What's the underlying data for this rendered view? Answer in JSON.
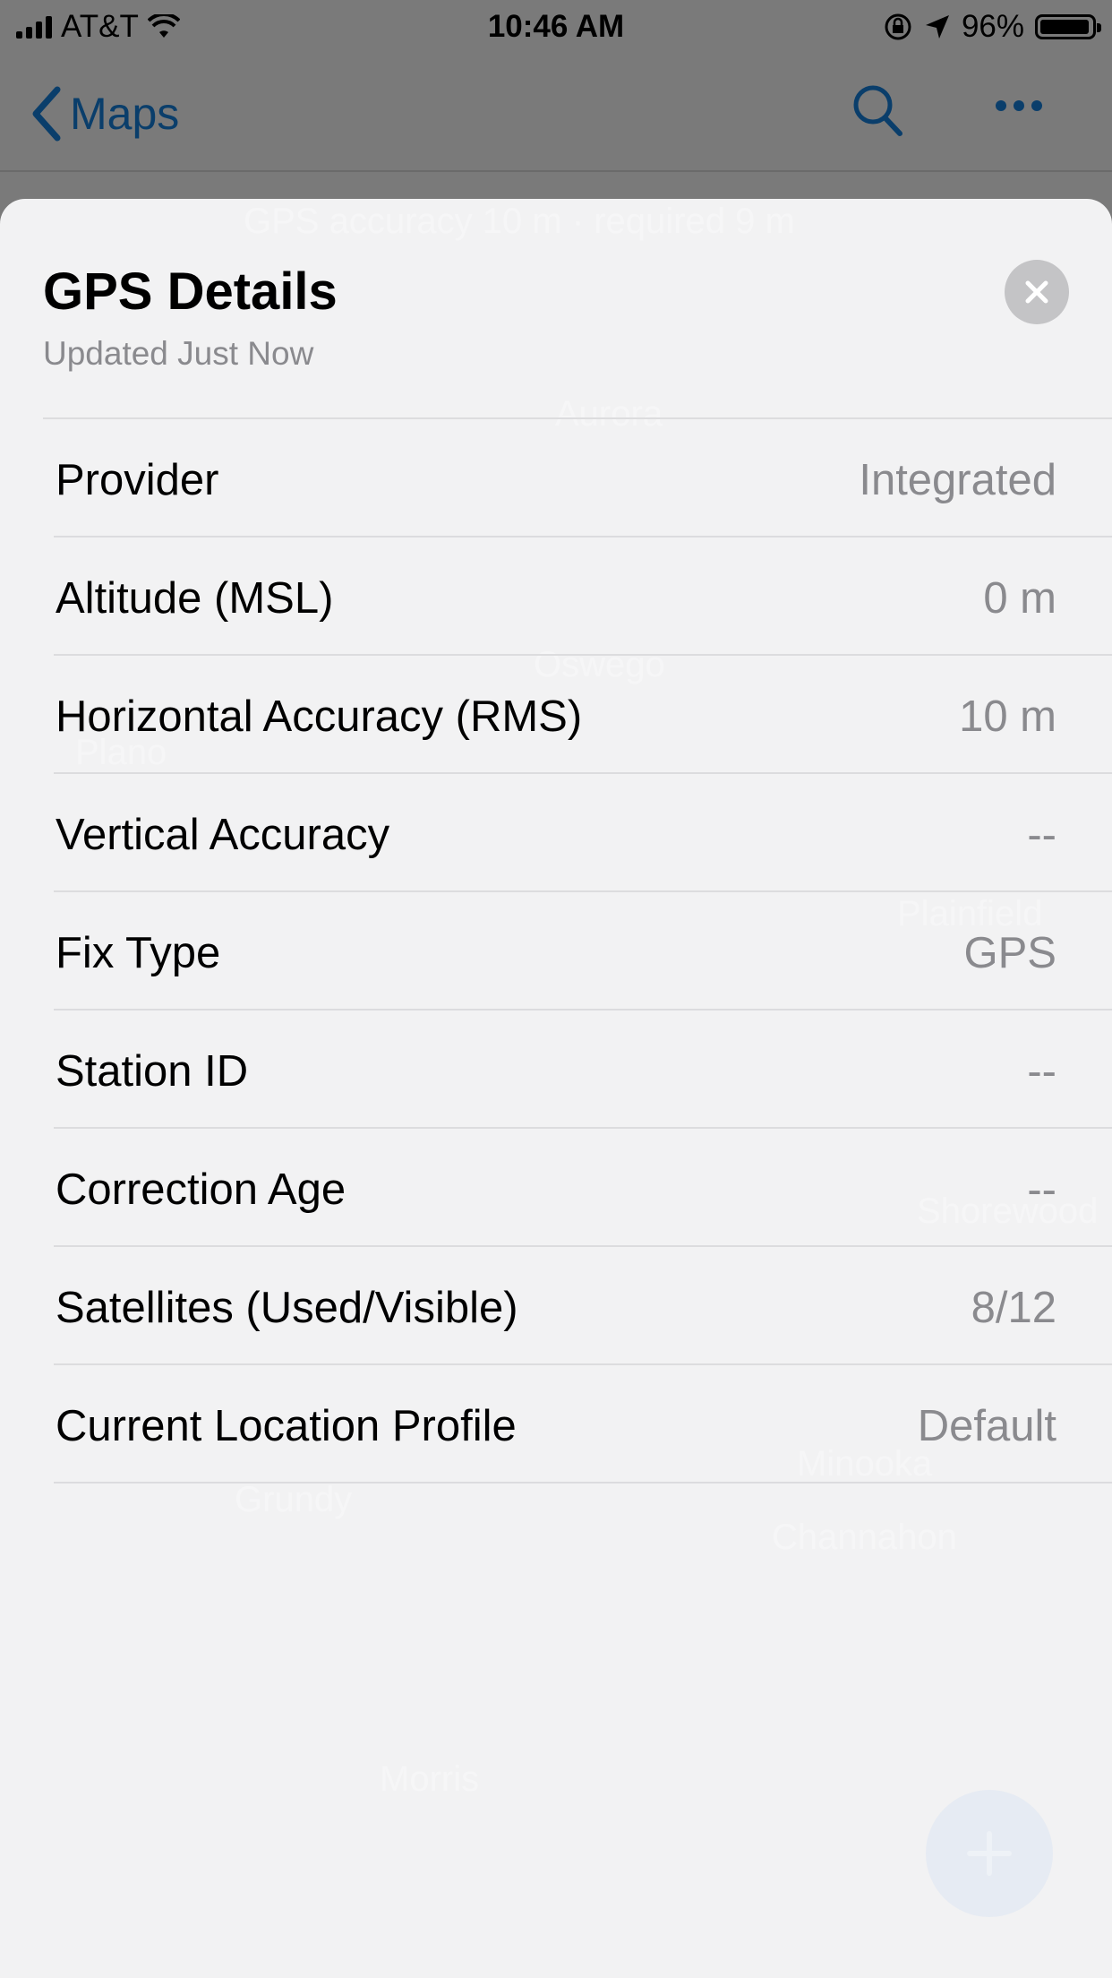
{
  "status_bar": {
    "carrier": "AT&T",
    "time": "10:46 AM",
    "battery_percent": "96%",
    "battery_level": 0.96,
    "icons": [
      "signal-icon",
      "wifi-icon",
      "rotation-lock-icon",
      "location-arrow-icon",
      "battery-icon"
    ]
  },
  "nav": {
    "back_label": "Maps",
    "icons": [
      "chevron-left-icon",
      "search-icon",
      "more-icon"
    ]
  },
  "background_map": {
    "banner": "GPS accuracy 10 m · required 9 m",
    "places": [
      "Aurora",
      "Oswego",
      "Plano",
      "Plainfield",
      "Shorewood",
      "Minooka",
      "Channahon",
      "Grundy",
      "Morris"
    ]
  },
  "sheet": {
    "title": "GPS Details",
    "subtitle": "Updated Just Now",
    "rows": [
      {
        "label": "Provider",
        "value": "Integrated"
      },
      {
        "label": "Altitude (MSL)",
        "value": "0 m"
      },
      {
        "label": "Horizontal Accuracy (RMS)",
        "value": "10 m"
      },
      {
        "label": "Vertical Accuracy",
        "value": "--"
      },
      {
        "label": "Fix Type",
        "value": "GPS"
      },
      {
        "label": "Station ID",
        "value": "--"
      },
      {
        "label": "Correction Age",
        "value": "--"
      },
      {
        "label": "Satellites (Used/Visible)",
        "value": "8/12"
      },
      {
        "label": "Current Location Profile",
        "value": "Default"
      }
    ]
  },
  "colors": {
    "accent": "#0a3e6b",
    "secondary_text": "#8a8a8e",
    "sheet_background": "#f7f7f8",
    "divider": "#dcdcde"
  }
}
